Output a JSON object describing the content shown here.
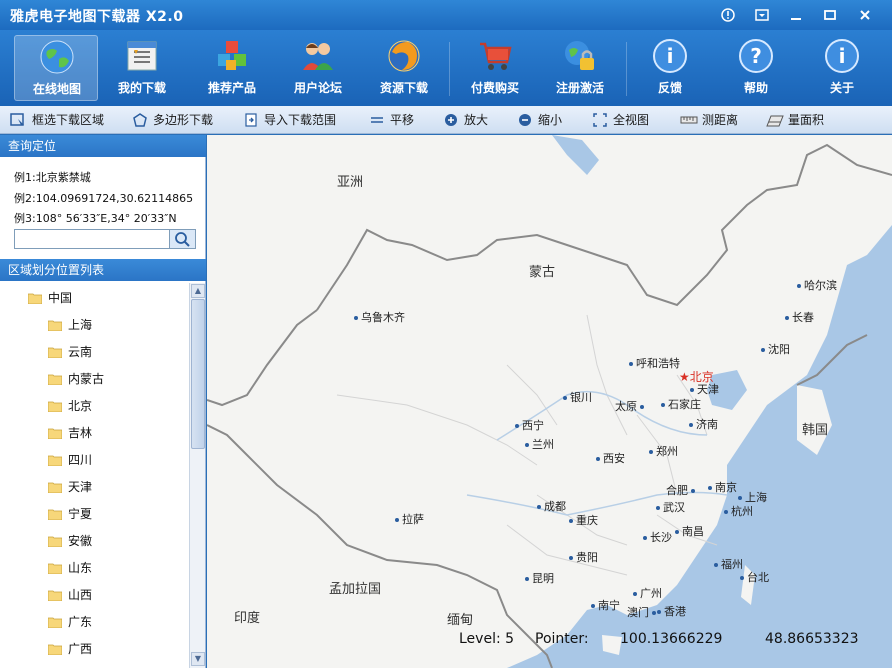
{
  "window": {
    "title": "雅虎电子地图下载器 X2.0"
  },
  "main_toolbar": {
    "items": [
      {
        "label": "在线地图",
        "icon": "globe-icon",
        "active": true
      },
      {
        "label": "我的下载",
        "icon": "download-list-icon"
      },
      {
        "label": "推荐产品",
        "icon": "cubes-icon"
      },
      {
        "label": "用户论坛",
        "icon": "users-icon"
      },
      {
        "label": "资源下载",
        "icon": "firefox-globe-icon"
      },
      {
        "label": "付费购买",
        "icon": "shopping-cart-icon"
      },
      {
        "label": "注册激活",
        "icon": "lock-globe-icon"
      },
      {
        "label": "反馈",
        "icon": "info-icon"
      },
      {
        "label": "帮助",
        "icon": "help-icon"
      },
      {
        "label": "关于",
        "icon": "about-icon"
      }
    ]
  },
  "map_toolbar": {
    "items": [
      {
        "label": "框选下载区域",
        "icon": "select-area-icon"
      },
      {
        "label": "多边形下载",
        "icon": "polygon-icon"
      },
      {
        "label": "导入下载范围",
        "icon": "import-icon"
      },
      {
        "label": "平移",
        "icon": "pan-icon"
      },
      {
        "label": "放大",
        "icon": "zoom-in-icon"
      },
      {
        "label": "缩小",
        "icon": "zoom-out-icon"
      },
      {
        "label": "全视图",
        "icon": "full-view-icon"
      },
      {
        "label": "测距离",
        "icon": "ruler-icon"
      },
      {
        "label": "量面积",
        "icon": "area-icon"
      }
    ]
  },
  "query": {
    "title": "查询定位",
    "examples": [
      "例1:北京紫禁城",
      "例2:104.09691724,30.62114865",
      "例3:108° 56′33″E,34° 20′33″N"
    ],
    "search_value": ""
  },
  "region_list": {
    "title": "区域划分位置列表",
    "root": "中国",
    "items": [
      "上海",
      "云南",
      "内蒙古",
      "北京",
      "吉林",
      "四川",
      "天津",
      "宁夏",
      "安徽",
      "山东",
      "山西",
      "广东",
      "广西"
    ]
  },
  "map": {
    "regions": [
      "亚洲",
      "蒙古",
      "韩国",
      "孟加拉国",
      "印度",
      "缅甸"
    ],
    "cities": [
      "哈尔滨",
      "长春",
      "沈阳",
      "乌鲁木齐",
      "呼和浩特",
      "北京",
      "天津",
      "银川",
      "太原",
      "石家庄",
      "西宁",
      "兰州",
      "济南",
      "郑州",
      "西安",
      "合肥",
      "南京",
      "上海",
      "成都",
      "武汉",
      "杭州",
      "拉萨",
      "重庆",
      "长沙",
      "南昌",
      "贵阳",
      "福州",
      "昆明",
      "台北",
      "广州",
      "南宁",
      "澳门",
      "香港"
    ],
    "capital_color": "#d93025"
  },
  "status": {
    "level": "Level: 5",
    "pointer_label": "Pointer:",
    "lon": "100.13666229",
    "lat": "48.86653323"
  },
  "colors": {
    "titlebar": "#1d6bbf",
    "sea": "#a9c7e6",
    "land": "#f4f4f2",
    "border": "#8a8a8a"
  }
}
